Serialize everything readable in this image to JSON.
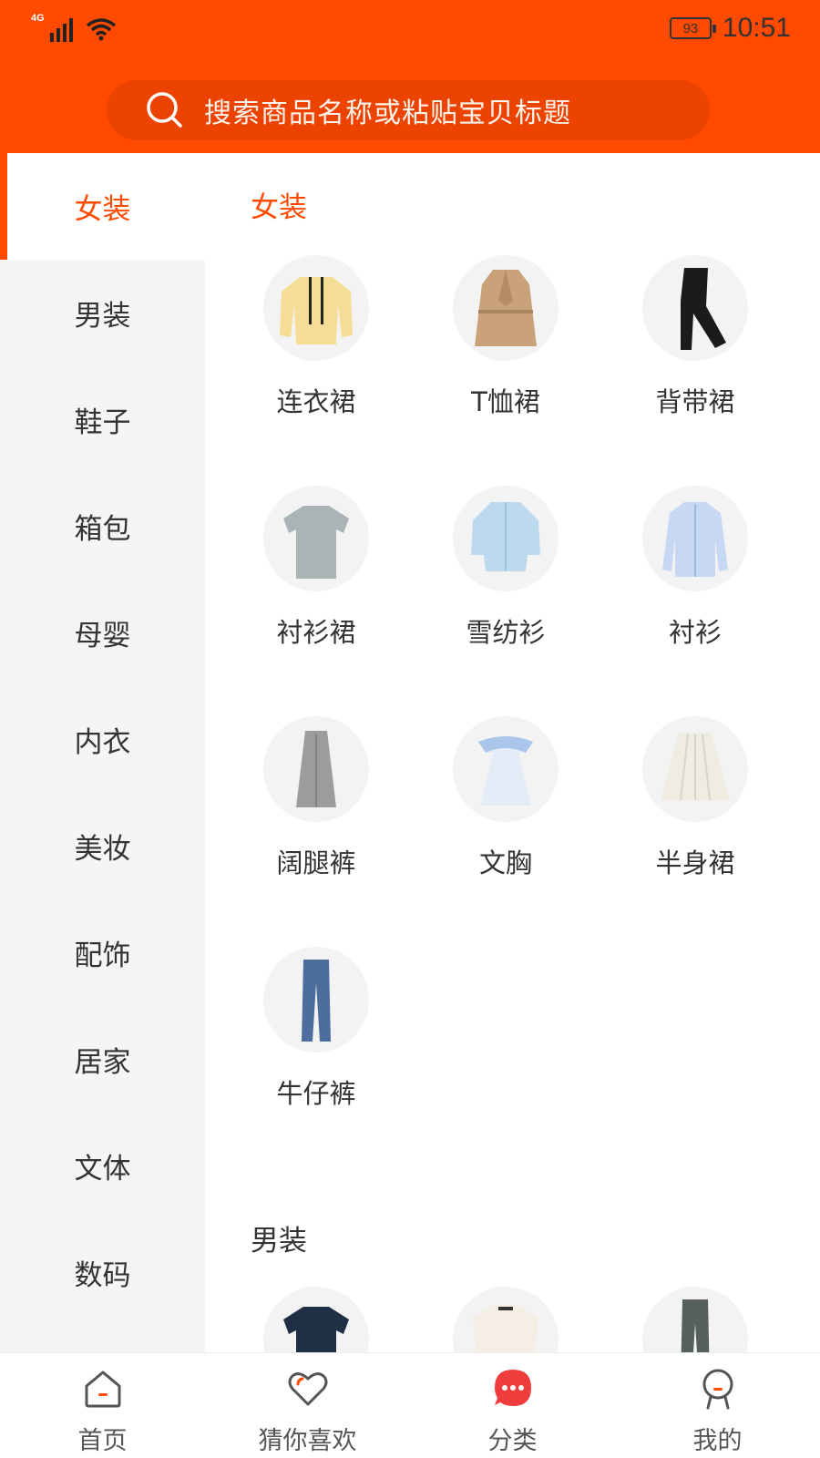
{
  "status_bar": {
    "network": "4G",
    "battery": "93",
    "time": "10:51"
  },
  "search": {
    "placeholder": "搜索商品名称或粘贴宝贝标题"
  },
  "sidebar": {
    "items": [
      {
        "label": "女装",
        "active": true
      },
      {
        "label": "男装",
        "active": false
      },
      {
        "label": "鞋子",
        "active": false
      },
      {
        "label": "箱包",
        "active": false
      },
      {
        "label": "母婴",
        "active": false
      },
      {
        "label": "内衣",
        "active": false
      },
      {
        "label": "美妆",
        "active": false
      },
      {
        "label": "配饰",
        "active": false
      },
      {
        "label": "居家",
        "active": false
      },
      {
        "label": "文体",
        "active": false
      },
      {
        "label": "数码",
        "active": false
      }
    ]
  },
  "main": {
    "sections": [
      {
        "title": "女装",
        "items": [
          {
            "label": "连衣裙",
            "icon": "yellow-sweater-icon"
          },
          {
            "label": "T恤裙",
            "icon": "trench-coat-icon"
          },
          {
            "label": "背带裙",
            "icon": "black-leggings-icon"
          },
          {
            "label": "衬衫裙",
            "icon": "gray-tshirt-icon"
          },
          {
            "label": "雪纺衫",
            "icon": "chiffon-blouse-icon"
          },
          {
            "label": "衬衫",
            "icon": "blue-shirt-icon"
          },
          {
            "label": "阔腿裤",
            "icon": "gray-skirt-icon"
          },
          {
            "label": "文胸",
            "icon": "white-dress-icon"
          },
          {
            "label": "半身裙",
            "icon": "pleated-skirt-icon"
          },
          {
            "label": "牛仔裤",
            "icon": "jeans-icon"
          }
        ]
      },
      {
        "title": "男装",
        "items": [
          {
            "label": "",
            "icon": "navy-tshirt-icon"
          },
          {
            "label": "",
            "icon": "white-sweater-icon"
          },
          {
            "label": "",
            "icon": "gray-pants-icon"
          }
        ]
      }
    ]
  },
  "tabbar": {
    "items": [
      {
        "label": "首页",
        "icon": "home-icon",
        "active": false
      },
      {
        "label": "猜你喜欢",
        "icon": "heart-icon",
        "active": false
      },
      {
        "label": "分类",
        "icon": "category-chat-icon",
        "active": true
      },
      {
        "label": "我的",
        "icon": "profile-icon",
        "active": false
      }
    ]
  },
  "colors": {
    "brand": "#ff4a00",
    "sidebar_bg": "#f5f5f5",
    "thumb_bg": "#f3f3f3"
  }
}
